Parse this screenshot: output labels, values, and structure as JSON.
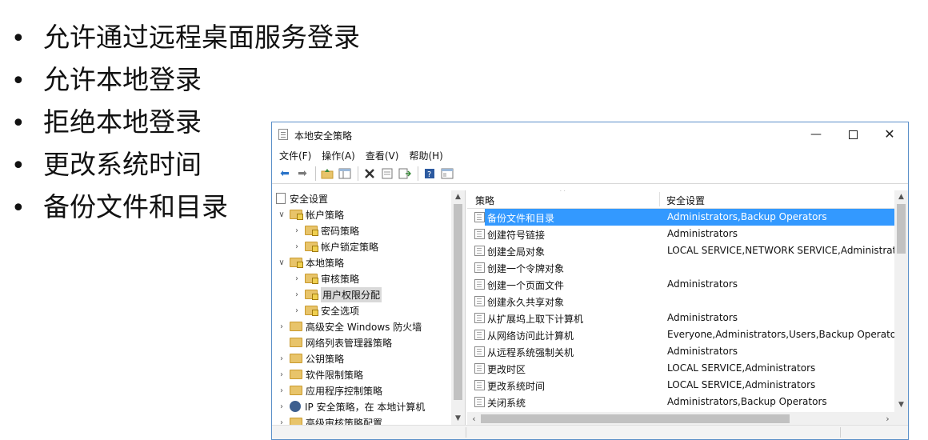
{
  "slide": {
    "bullets": [
      "允许通过远程桌面服务登录",
      "允许本地登录",
      "拒绝本地登录",
      "更改系统时间",
      "备份文件和目录"
    ]
  },
  "window": {
    "title": "本地安全策略",
    "controls": {
      "minimize": "—",
      "close": "✕"
    }
  },
  "menu": [
    "文件(F)",
    "操作(A)",
    "查看(V)",
    "帮助(H)"
  ],
  "toolbar": [
    "back-arrow",
    "forward-arrow",
    "folder-up",
    "show-hide-tree",
    "delete",
    "properties",
    "export-list",
    "help",
    "console-tree"
  ],
  "tree": {
    "root": "安全设置",
    "items": [
      {
        "label": "帐户策略",
        "level": 1,
        "expanded": true
      },
      {
        "label": "密码策略",
        "level": 2,
        "expanded": false
      },
      {
        "label": "帐户锁定策略",
        "level": 2,
        "expanded": false
      },
      {
        "label": "本地策略",
        "level": 1,
        "expanded": true
      },
      {
        "label": "审核策略",
        "level": 2,
        "expanded": false
      },
      {
        "label": "用户权限分配",
        "level": 2,
        "expanded": false,
        "selected": true
      },
      {
        "label": "安全选项",
        "level": 2,
        "expanded": false
      },
      {
        "label": "高级安全 Windows 防火墙",
        "level": 1,
        "expanded": false
      },
      {
        "label": "网络列表管理器策略",
        "level": 1,
        "expanded": null
      },
      {
        "label": "公钥策略",
        "level": 1,
        "expanded": false
      },
      {
        "label": "软件限制策略",
        "level": 1,
        "expanded": false
      },
      {
        "label": "应用程序控制策略",
        "level": 1,
        "expanded": false
      },
      {
        "label": "IP 安全策略，在 本地计算机",
        "level": 1,
        "expanded": false
      },
      {
        "label": "高级审核策略配置",
        "level": 1,
        "expanded": false
      }
    ]
  },
  "list": {
    "columns": [
      "策略",
      "安全设置"
    ],
    "rows": [
      {
        "policy": "备份文件和目录",
        "setting": "Administrators,Backup Operators",
        "selected": true
      },
      {
        "policy": "创建符号链接",
        "setting": "Administrators"
      },
      {
        "policy": "创建全局对象",
        "setting": "LOCAL SERVICE,NETWORK SERVICE,Administrato"
      },
      {
        "policy": "创建一个令牌对象",
        "setting": ""
      },
      {
        "policy": "创建一个页面文件",
        "setting": "Administrators"
      },
      {
        "policy": "创建永久共享对象",
        "setting": ""
      },
      {
        "policy": "从扩展坞上取下计算机",
        "setting": "Administrators"
      },
      {
        "policy": "从网络访问此计算机",
        "setting": "Everyone,Administrators,Users,Backup Operators"
      },
      {
        "policy": "从远程系统强制关机",
        "setting": "Administrators"
      },
      {
        "policy": "更改时区",
        "setting": "LOCAL SERVICE,Administrators"
      },
      {
        "policy": "更改系统时间",
        "setting": "LOCAL SERVICE,Administrators"
      },
      {
        "policy": "关闭系统",
        "setting": "Administrators,Backup Operators"
      }
    ]
  },
  "colors": {
    "selection": "#3399ff",
    "window_border": "#5a8fc8",
    "folder": "#e8c46a"
  }
}
